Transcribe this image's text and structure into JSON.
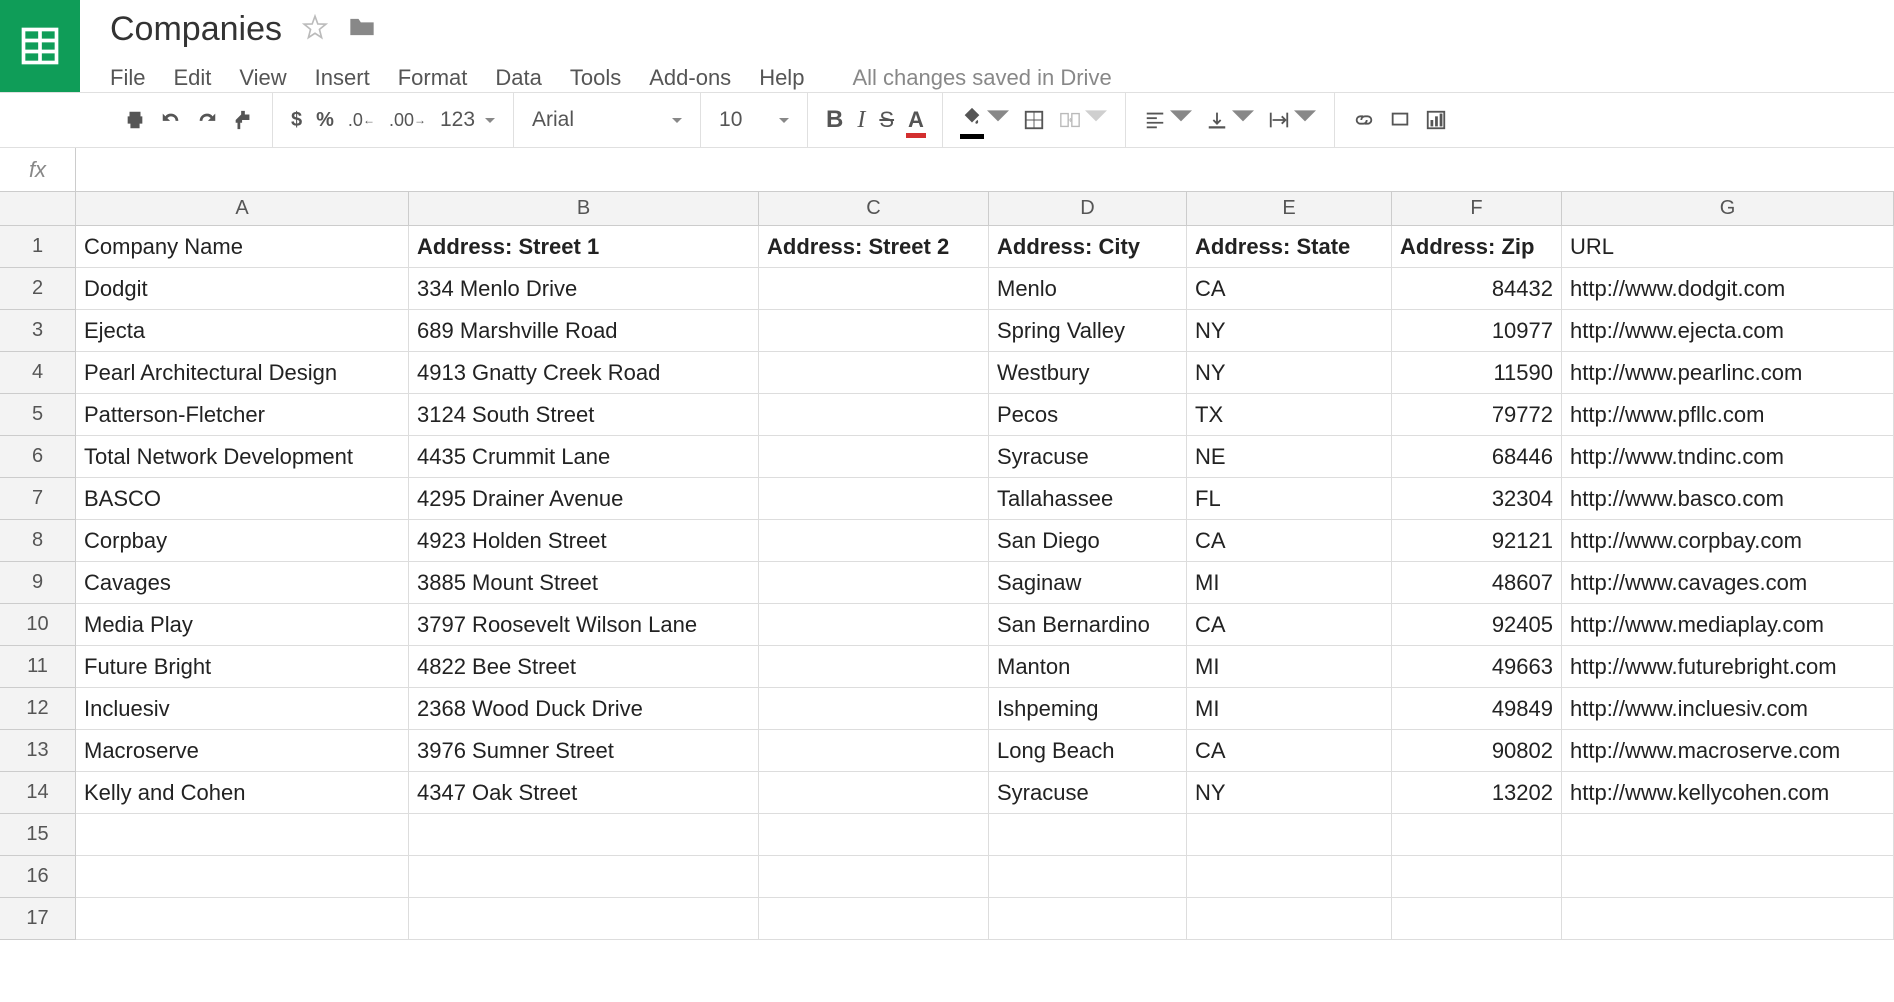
{
  "header": {
    "doc_title": "Companies",
    "save_status": "All changes saved in Drive"
  },
  "menubar": {
    "items": [
      "File",
      "Edit",
      "View",
      "Insert",
      "Format",
      "Data",
      "Tools",
      "Add-ons",
      "Help"
    ]
  },
  "toolbar": {
    "currency": "$",
    "percent": "%",
    "dec_decrease": ".0_",
    "dec_increase": ".00_",
    "num_format": "123",
    "font_name": "Arial",
    "font_size": "10"
  },
  "formula_bar": {
    "label": "fx",
    "value": ""
  },
  "columns": [
    "A",
    "B",
    "C",
    "D",
    "E",
    "F",
    "G"
  ],
  "sheet": {
    "headers": {
      "A": "Company Name",
      "B": "Address: Street 1",
      "C": "Address: Street 2",
      "D": "Address: City",
      "E": "Address: State",
      "F": "Address: Zip",
      "G": "URL"
    },
    "header_bold": {
      "A": false,
      "B": true,
      "C": true,
      "D": true,
      "E": true,
      "F": true,
      "G": false
    },
    "rows": [
      {
        "A": "Dodgit",
        "B": "334 Menlo Drive",
        "C": "",
        "D": "Menlo",
        "E": "CA",
        "F": "84432",
        "G": "http://www.dodgit.com"
      },
      {
        "A": "Ejecta",
        "B": "689 Marshville Road",
        "C": "",
        "D": "Spring Valley",
        "E": "NY",
        "F": "10977",
        "G": "http://www.ejecta.com"
      },
      {
        "A": "Pearl Architectural Design",
        "B": "4913 Gnatty Creek Road",
        "C": "",
        "D": "Westbury",
        "E": "NY",
        "F": "11590",
        "G": "http://www.pearlinc.com"
      },
      {
        "A": "Patterson-Fletcher",
        "B": "3124 South Street",
        "C": "",
        "D": "Pecos",
        "E": "TX",
        "F": "79772",
        "G": "http://www.pfllc.com"
      },
      {
        "A": "Total Network Development",
        "B": "4435 Crummit Lane",
        "C": "",
        "D": "Syracuse",
        "E": "NE",
        "F": "68446",
        "G": "http://www.tndinc.com"
      },
      {
        "A": "BASCO",
        "B": "4295 Drainer Avenue",
        "C": "",
        "D": "Tallahassee",
        "E": "FL",
        "F": "32304",
        "G": "http://www.basco.com"
      },
      {
        "A": "Corpbay",
        "B": "4923 Holden Street",
        "C": "",
        "D": "San Diego",
        "E": "CA",
        "F": "92121",
        "G": "http://www.corpbay.com"
      },
      {
        "A": "Cavages",
        "B": "3885 Mount Street",
        "C": "",
        "D": "Saginaw",
        "E": "MI",
        "F": "48607",
        "G": "http://www.cavages.com"
      },
      {
        "A": "Media Play",
        "B": "3797 Roosevelt Wilson Lane",
        "C": "",
        "D": "San Bernardino",
        "E": "CA",
        "F": "92405",
        "G": "http://www.mediaplay.com"
      },
      {
        "A": "Future Bright",
        "B": "4822 Bee Street",
        "C": "",
        "D": "Manton",
        "E": "MI",
        "F": "49663",
        "G": "http://www.futurebright.com"
      },
      {
        "A": "Incluesiv",
        "B": "2368 Wood Duck Drive",
        "C": "",
        "D": "Ishpeming",
        "E": "MI",
        "F": "49849",
        "G": "http://www.incluesiv.com"
      },
      {
        "A": "Macroserve",
        "B": "3976 Sumner Street",
        "C": "",
        "D": "Long Beach",
        "E": "CA",
        "F": "90802",
        "G": "http://www.macroserve.com"
      },
      {
        "A": "Kelly and Cohen",
        "B": "4347 Oak Street",
        "C": "",
        "D": "Syracuse",
        "E": "NY",
        "F": "13202",
        "G": "http://www.kellycohen.com"
      }
    ],
    "empty_row_count": 3
  }
}
